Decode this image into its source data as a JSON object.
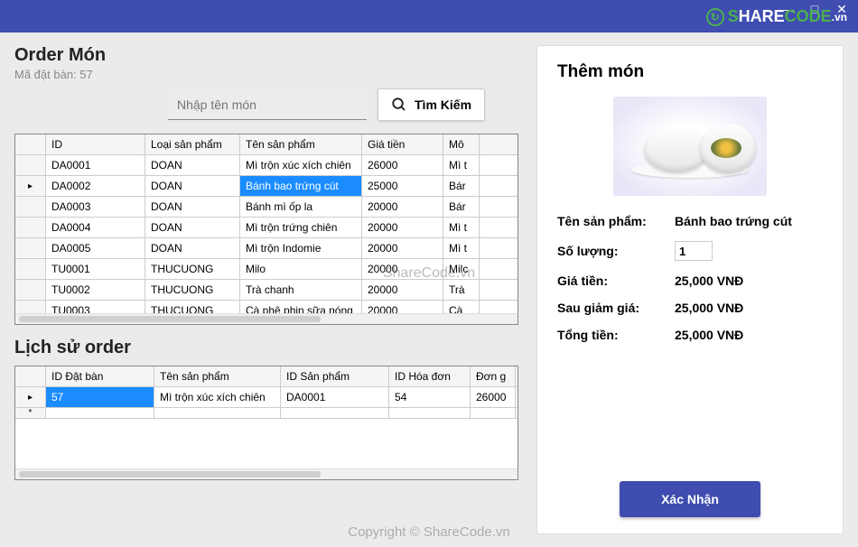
{
  "window": {
    "minimize": "—",
    "maximize": "□",
    "close": "✕"
  },
  "logo": {
    "s": "S",
    "hare": "HARE",
    "code": "CODE",
    "vn": ".vn"
  },
  "left": {
    "title": "Order Món",
    "subtitle": "Mã đặt bàn: 57",
    "search_placeholder": "Nhập tên món",
    "search_button": "Tìm Kiếm",
    "products": {
      "headers": [
        "ID",
        "Loại sản phẩm",
        "Tên sản phẩm",
        "Giá tiền",
        "Mô"
      ],
      "selected_index": 1,
      "row_marker_index": 1,
      "rows": [
        {
          "id": "DA0001",
          "type": "DOAN",
          "name": "Mì trộn xúc xích chiên",
          "price": "26000",
          "last": "Mì t"
        },
        {
          "id": "DA0002",
          "type": "DOAN",
          "name": "Bánh bao trứng cút",
          "price": "25000",
          "last": "Bár"
        },
        {
          "id": "DA0003",
          "type": "DOAN",
          "name": "Bánh mì ốp la",
          "price": "20000",
          "last": "Bár"
        },
        {
          "id": "DA0004",
          "type": "DOAN",
          "name": "Mì trộn trứng chiên",
          "price": "20000",
          "last": "Mì t"
        },
        {
          "id": "DA0005",
          "type": "DOAN",
          "name": "Mì trộn Indomie",
          "price": "20000",
          "last": "Mì t"
        },
        {
          "id": "TU0001",
          "type": "THUCUONG",
          "name": "Milo",
          "price": "20000",
          "last": "Milc"
        },
        {
          "id": "TU0002",
          "type": "THUCUONG",
          "name": "Trà chanh",
          "price": "20000",
          "last": "Trà"
        },
        {
          "id": "TU0003",
          "type": "THUCUONG",
          "name": "Cà phê phin sữa nóng",
          "price": "20000",
          "last": "Cà"
        }
      ]
    },
    "history_title": "Lịch sử order",
    "history": {
      "headers": [
        "ID Đặt bàn",
        "Tên sản phẩm",
        "ID Sản phẩm",
        "ID Hóa đơn",
        "Đơn g"
      ],
      "rows": [
        {
          "a": "57",
          "b": "Mì trộn xúc xích chiên",
          "c": "DA0001",
          "d": "54",
          "e": "26000"
        }
      ]
    }
  },
  "right": {
    "title": "Thêm món",
    "labels": {
      "name": "Tên sản phẩm:",
      "qty": "Số lượng:",
      "price": "Giá tiền:",
      "discounted": "Sau giảm giá:",
      "total": "Tổng tiền:"
    },
    "values": {
      "name": "Bánh bao trứng cút",
      "qty": "1",
      "price": "25,000 VNĐ",
      "discounted": "25,000 VNĐ",
      "total": "25,000 VNĐ"
    },
    "confirm": "Xác Nhận"
  },
  "watermarks": {
    "center": "ShareCode.vn",
    "bottom": "Copyright © ShareCode.vn"
  }
}
